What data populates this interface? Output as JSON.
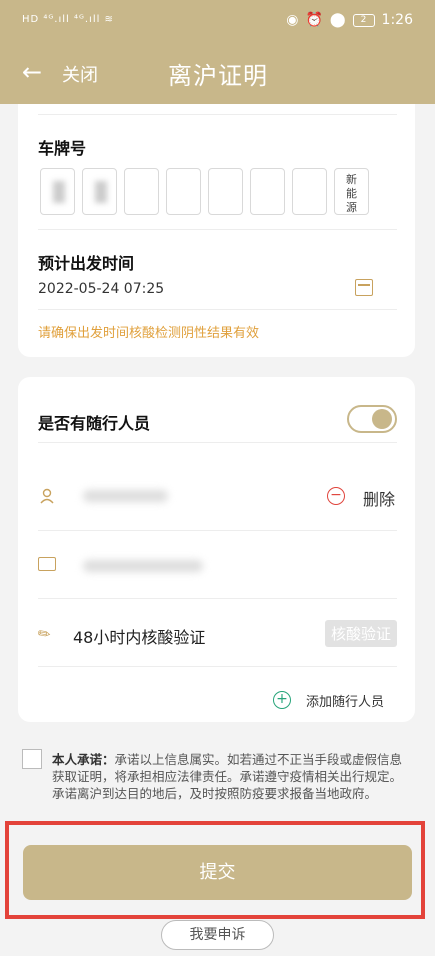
{
  "status_bar": {
    "left_text": "HD ⁴ᴳ.ıll ⁴ᴳ.ıll ≋",
    "battery": "2",
    "time": "1:26"
  },
  "nav": {
    "back_icon": "←",
    "close_label": "关闭",
    "title": "离沪证明"
  },
  "plate_section": {
    "label": "车牌号",
    "new_energy_label": "新能源"
  },
  "departure": {
    "label": "预计出发时间",
    "value": "2022-05-24 07:25",
    "notice": "请确保出发时间核酸检测阴性结果有效"
  },
  "companions": {
    "toggle_label": "是否有随行人员",
    "delete_label": "删除",
    "nucleic_label": "48小时内核酸验证",
    "nucleic_button": "核酸验证",
    "add_label": "添加随行人员"
  },
  "pledge": {
    "title": "本人承诺：",
    "text": "承诺以上信息属实。如若通过不正当手段或虚假信息获取证明，将承担相应法律责任。承诺遵守疫情相关出行规定。承诺离沪到达目的地后，及时按照防疫要求报备当地政府。"
  },
  "submit_label": "提交",
  "appeal_label": "我要申诉",
  "colors": {
    "theme": "#c8b78a",
    "notice": "#e0a03c",
    "highlight": "#e3433a",
    "add": "#27a47a",
    "delete": "#e0443c"
  }
}
